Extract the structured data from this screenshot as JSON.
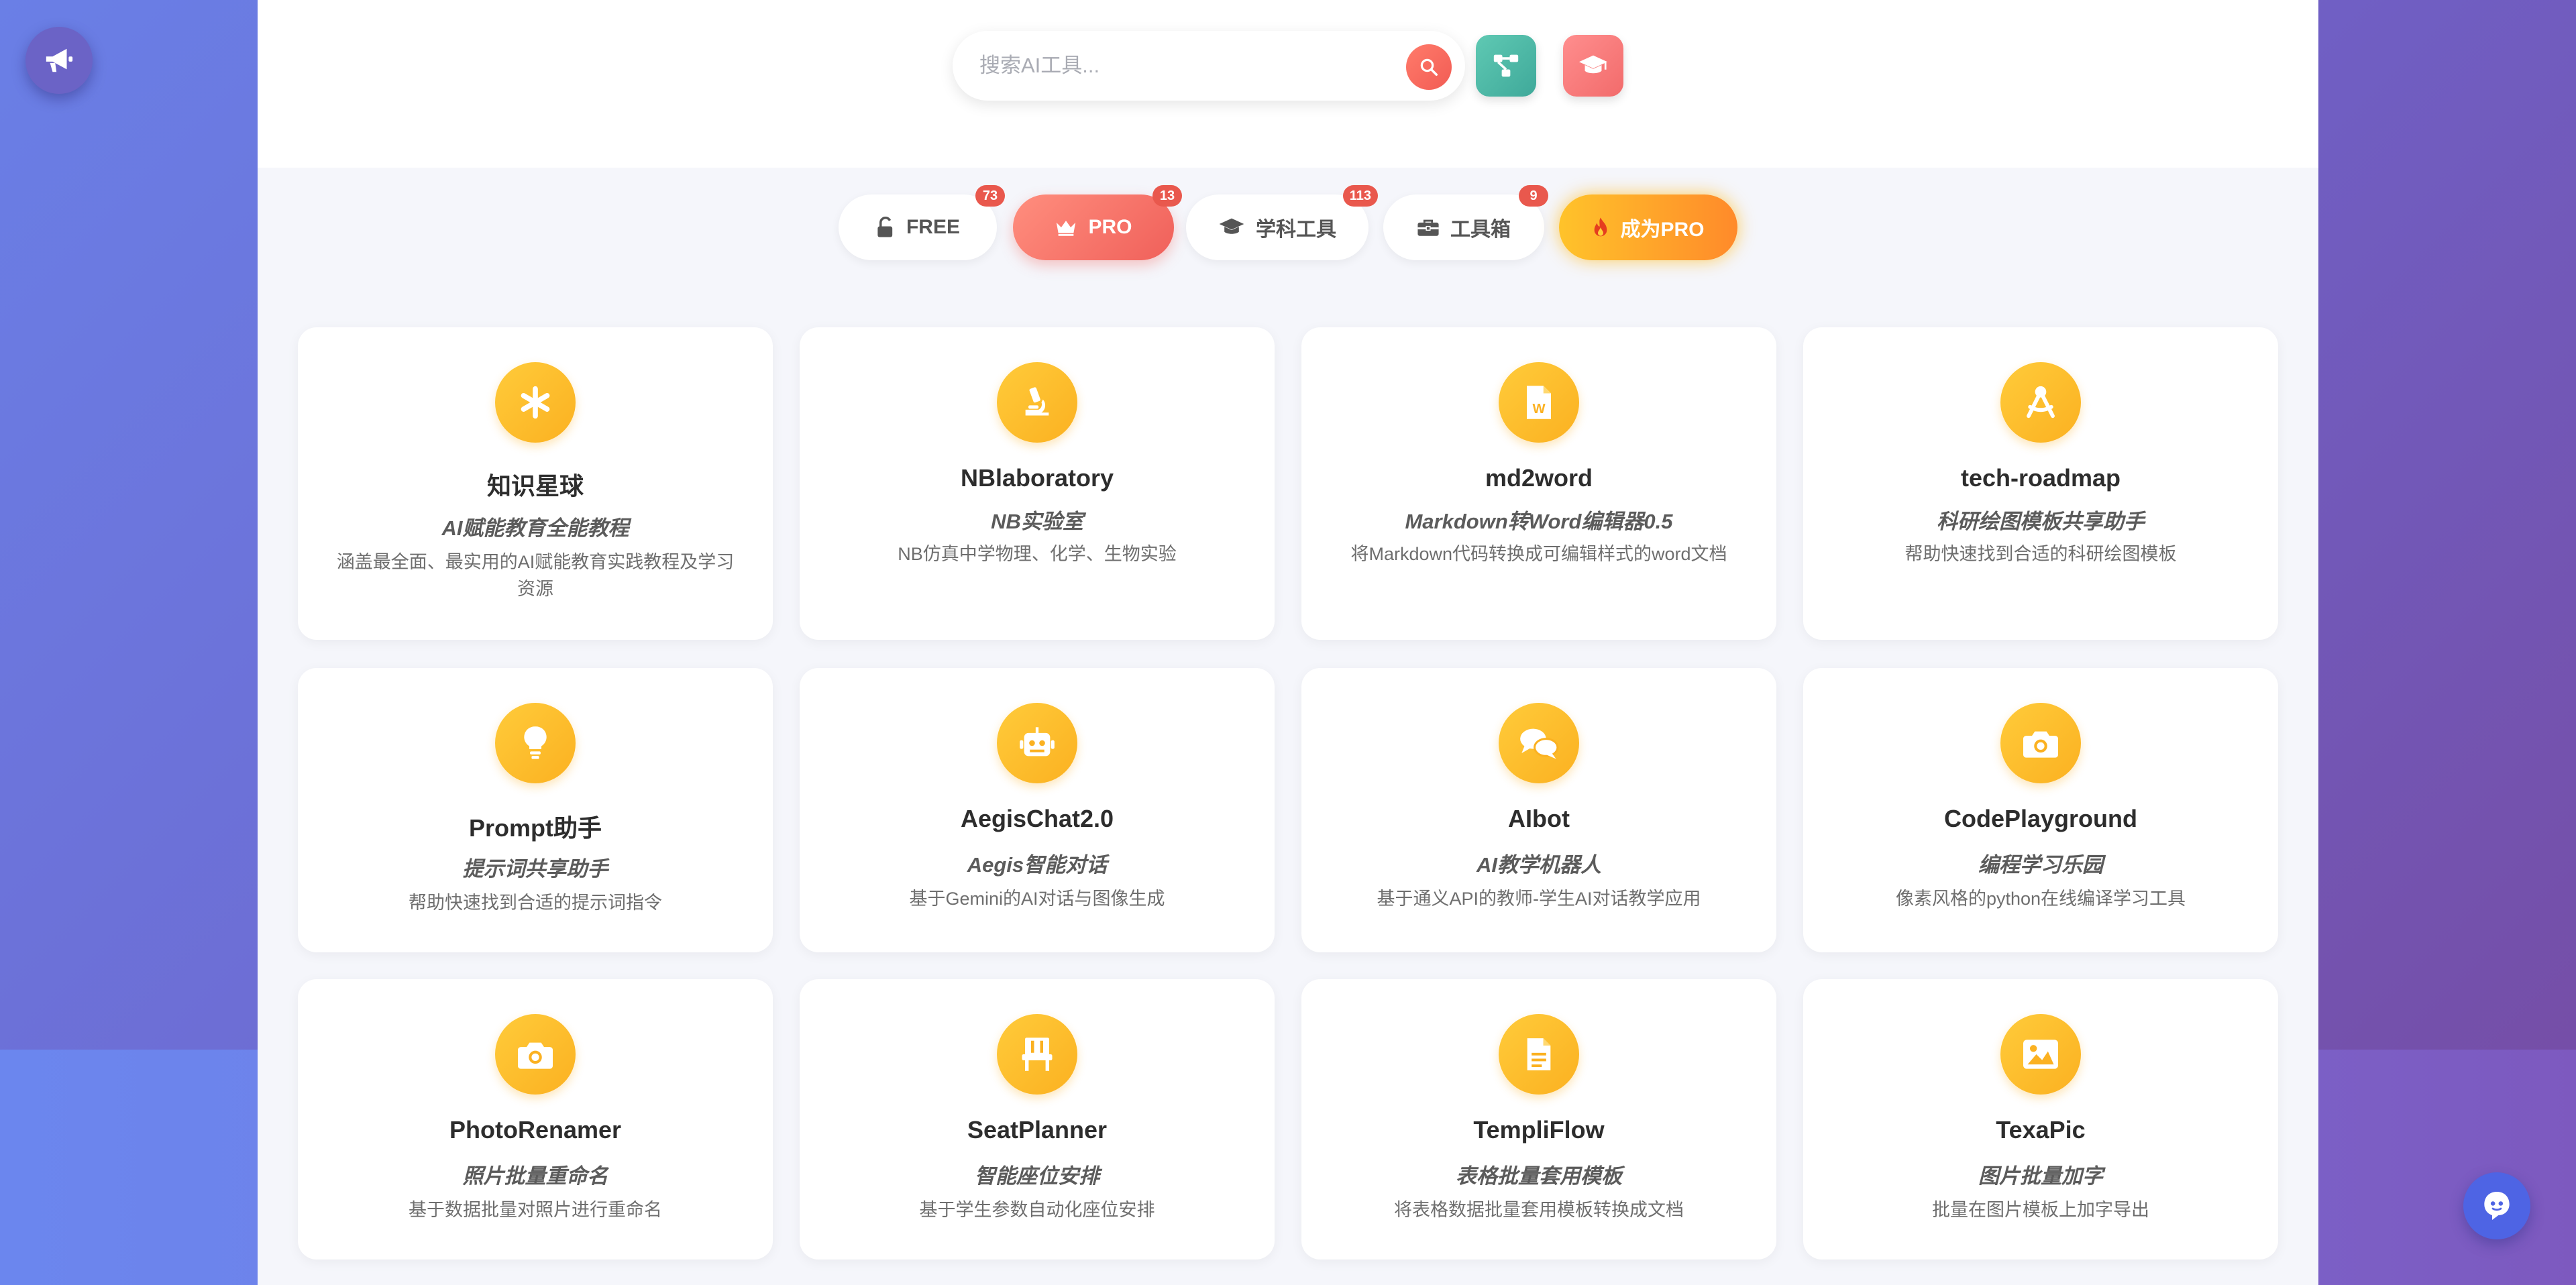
{
  "search": {
    "placeholder": "搜索AI工具..."
  },
  "header_buttons": {
    "network_icon": "network-icon",
    "learn_icon": "graduation-cap-icon"
  },
  "tabs": [
    {
      "label": "FREE",
      "badge": "73",
      "icon": "unlock-icon"
    },
    {
      "label": "PRO",
      "badge": "13",
      "icon": "crown-icon"
    },
    {
      "label": "学科工具",
      "badge": "113",
      "icon": "graduation-cap-icon"
    },
    {
      "label": "工具箱",
      "badge": "9",
      "icon": "toolbox-icon"
    },
    {
      "label": "成为PRO",
      "icon": "fire-icon"
    }
  ],
  "cards": [
    {
      "icon": "asterisk-icon",
      "title": "知识星球",
      "subtitle": "AI赋能教育全能教程",
      "desc": "涵盖最全面、最实用的AI赋能教育实践教程及学习资源"
    },
    {
      "icon": "microscope-icon",
      "title": "NBlaboratory",
      "subtitle": "NB实验室",
      "desc": "NB仿真中学物理、化学、生物实验"
    },
    {
      "icon": "word-file-icon",
      "title": "md2word",
      "subtitle": "Markdown转Word编辑器0.5",
      "desc": "将Markdown代码转换成可编辑样式的word文档"
    },
    {
      "icon": "compass-drafting-icon",
      "title": "tech-roadmap",
      "subtitle": "科研绘图模板共享助手",
      "desc": "帮助快速找到合适的科研绘图模板"
    },
    {
      "icon": "lightbulb-icon",
      "title": "Prompt助手",
      "subtitle": "提示词共享助手",
      "desc": "帮助快速找到合适的提示词指令"
    },
    {
      "icon": "robot-icon",
      "title": "AegisChat2.0",
      "subtitle": "Aegis智能对话",
      "desc": "基于Gemini的AI对话与图像生成"
    },
    {
      "icon": "comments-icon",
      "title": "AIbot",
      "subtitle": "AI教学机器人",
      "desc": "基于通义API的教师-学生AI对话教学应用"
    },
    {
      "icon": "camera-icon",
      "title": "CodePlayground",
      "subtitle": "编程学习乐园",
      "desc": "像素风格的python在线编译学习工具"
    },
    {
      "icon": "camera-icon",
      "title": "PhotoRenamer",
      "subtitle": "照片批量重命名",
      "desc": "基于数据批量对照片进行重命名"
    },
    {
      "icon": "chair-icon",
      "title": "SeatPlanner",
      "subtitle": "智能座位安排",
      "desc": "基于学生参数自动化座位安排"
    },
    {
      "icon": "document-icon",
      "title": "TempliFlow",
      "subtitle": "表格批量套用模板",
      "desc": "将表格数据批量套用模板转换成文档"
    },
    {
      "icon": "image-icon",
      "title": "TexaPic",
      "subtitle": "图片批量加字",
      "desc": "批量在图片模板上加字导出"
    }
  ],
  "floating": {
    "announce_icon": "megaphone-icon",
    "chat_icon": "chat-bot-icon"
  },
  "colors": {
    "accent_pro": "#f0605a",
    "card_icon": "#fbb121",
    "become_pro": "#ff8a2a",
    "badge": "#e9584d"
  }
}
